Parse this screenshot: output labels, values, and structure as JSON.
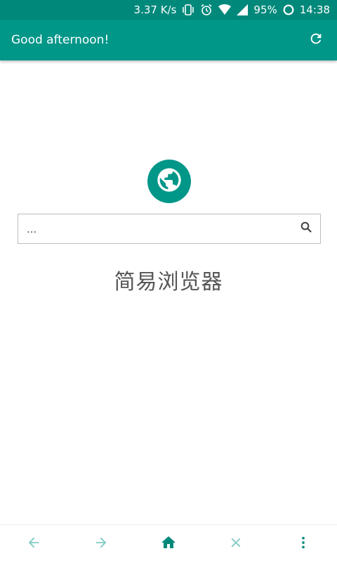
{
  "status_bar": {
    "net_speed": "3.37 K/s",
    "battery": "95%",
    "time": "14:38",
    "icons": [
      "vibrate-icon",
      "alarm-icon",
      "wifi-icon",
      "signal-icon",
      "battery-ring-icon"
    ]
  },
  "toolbar": {
    "title": "Good afternoon!",
    "refresh_icon": "refresh-icon"
  },
  "logo": {
    "icon": "globe-icon"
  },
  "search": {
    "placeholder": "...",
    "value": "",
    "icon": "search-icon"
  },
  "app_name": "简易浏览器",
  "bottom_nav": {
    "items": [
      {
        "icon": "arrow-back-icon",
        "enabled": false
      },
      {
        "icon": "arrow-forward-icon",
        "enabled": false
      },
      {
        "icon": "home-icon",
        "enabled": true
      },
      {
        "icon": "close-icon",
        "enabled": false
      },
      {
        "icon": "more-vert-icon",
        "enabled": true
      }
    ]
  },
  "colors": {
    "primary": "#009688",
    "primary_dark": "#00897b",
    "disabled_icon": "#80cbc4",
    "text": "#555555"
  }
}
